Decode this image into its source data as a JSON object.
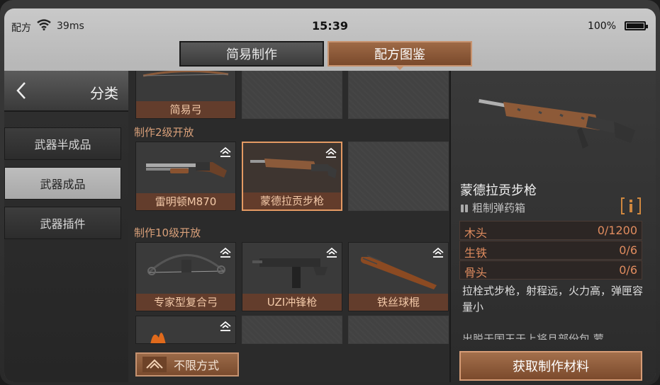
{
  "status": {
    "carrier": "配方",
    "network_speed": "39ms",
    "time": "15:39",
    "battery": "100%"
  },
  "tabs": [
    {
      "label": "简易制作",
      "active": false
    },
    {
      "label": "配方图鉴",
      "active": true
    }
  ],
  "sidebar": {
    "header": "分类",
    "items": [
      {
        "label": "武器半成品",
        "active": false
      },
      {
        "label": "武器成品",
        "active": true
      },
      {
        "label": "武器插件",
        "active": false
      }
    ]
  },
  "grid": {
    "top_row": [
      {
        "label": "简易弓"
      }
    ],
    "sections": [
      {
        "title": "制作2级开放",
        "items": [
          {
            "label": "雷明顿M870"
          },
          {
            "label": "蒙德拉贡步枪",
            "selected": true
          }
        ]
      },
      {
        "title": "制作10级开放",
        "items": [
          {
            "label": "专家型复合弓"
          },
          {
            "label": "UZI冲锋枪"
          },
          {
            "label": "铁丝球棍"
          }
        ]
      }
    ],
    "filter_label": "不限方式"
  },
  "detail": {
    "name": "蒙德拉贡步枪",
    "ammo": "粗制弹药箱",
    "materials": [
      {
        "name": "木头",
        "qty": "0/1200"
      },
      {
        "name": "生铁",
        "qty": "0/6"
      },
      {
        "name": "骨头",
        "qty": "0/6"
      }
    ],
    "description": "拉栓式步枪，射程远，火力高，弹匣容量小",
    "description_cut": "出脱于国王于上将且部份包 蒙",
    "action_label": "获取制作材料"
  },
  "colors": {
    "accent": "#e49a63",
    "tab_active": "#8a5a3a",
    "material_text": "#e08c5f"
  }
}
